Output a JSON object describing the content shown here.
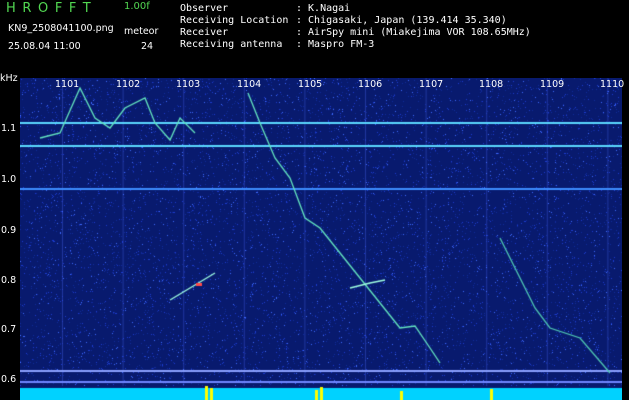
{
  "header": {
    "logo": "HROFFT",
    "version": "1.00f",
    "filename": "KN9_2508041100.png",
    "meteor_label": "meteor",
    "datetime": "25.08.04 11:00",
    "count": "24",
    "info": [
      {
        "label": "Observer",
        "value": ": K.Nagai"
      },
      {
        "label": "Receiving Location",
        "value": ": Chigasaki, Japan (139.414 35.340)"
      },
      {
        "label": "Receiver",
        "value": ": AirSpy mini (Miakejima VOR 108.65MHz)"
      },
      {
        "label": "Receiving antenna",
        "value": ": Maspro FM-3"
      }
    ]
  },
  "spectrogram": {
    "y_unit": "kHz",
    "y_ticks": [
      "1.1",
      "1.0",
      "0.9",
      "0.8",
      "0.7",
      "0.6"
    ],
    "x_ticks": [
      "1101",
      "1102",
      "1103",
      "1104",
      "1105",
      "1106",
      "1107",
      "1108",
      "1109",
      "1110"
    ],
    "colors": {
      "background": "#081a6e",
      "noise": "#2a52ff",
      "signal": "#7dffd8",
      "bar": "#00d2ff",
      "peak": "#ffff00"
    }
  }
}
